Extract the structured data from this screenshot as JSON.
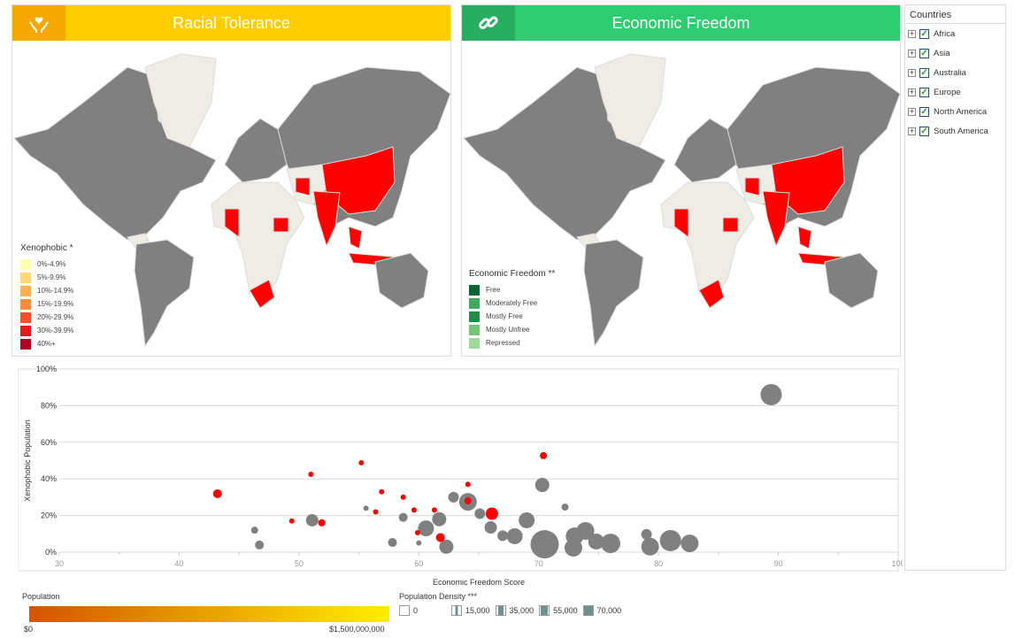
{
  "panels": {
    "racial": {
      "title": "Racial Tolerance",
      "icon": "hands-heart-icon",
      "header_color": "#ffcc00",
      "icon_bg": "#f5a800",
      "legend_title": "Xenophobic *",
      "legend": [
        {
          "label": "0%-4.9%",
          "color": "#ffffb2"
        },
        {
          "label": "5%-9.9%",
          "color": "#fed976"
        },
        {
          "label": "10%-14.9%",
          "color": "#feb24c"
        },
        {
          "label": "15%-19.9%",
          "color": "#fd8d3c"
        },
        {
          "label": "20%-29.9%",
          "color": "#fc4e2a"
        },
        {
          "label": "30%-39.9%",
          "color": "#e31a1c"
        },
        {
          "label": "40%+",
          "color": "#b10026"
        }
      ]
    },
    "economic": {
      "title": "Economic Freedom",
      "icon": "link-icon",
      "header_color": "#2ecc71",
      "icon_bg": "#27ae60",
      "legend_title": "Economic Freedom **",
      "legend": [
        {
          "label": "Free",
          "color": "#006837"
        },
        {
          "label": "Moderately Free",
          "color": "#41ab5d"
        },
        {
          "label": "Mostly Free",
          "color": "#238b45"
        },
        {
          "label": "Mostly Unfree",
          "color": "#74c476"
        },
        {
          "label": "Repressed",
          "color": "#a1d99b"
        }
      ]
    }
  },
  "sidebar": {
    "title": "Countries",
    "items": [
      {
        "label": "Africa",
        "checked": true
      },
      {
        "label": "Asia",
        "checked": true
      },
      {
        "label": "Australia",
        "checked": true
      },
      {
        "label": "Europe",
        "checked": true
      },
      {
        "label": "North America",
        "checked": true
      },
      {
        "label": "South America",
        "checked": true
      }
    ]
  },
  "chart_data": {
    "type": "scatter",
    "xlabel": "Economic Freedom Score",
    "ylabel": "Xenophobic Population",
    "xlim": [
      30,
      100
    ],
    "ylim": [
      0,
      100
    ],
    "xticks": [
      "30",
      "40",
      "50",
      "60",
      "70",
      "80",
      "90",
      "100"
    ],
    "yticks": [
      "0%",
      "20%",
      "40%",
      "60%",
      "80%",
      "100%"
    ],
    "grid": true,
    "colors": {
      "xenophobic": "#ff0000",
      "other": "#808080"
    },
    "points": [
      {
        "x": 89.4,
        "y": 86,
        "s": 12,
        "c": "other"
      },
      {
        "x": 43.2,
        "y": 31.9,
        "s": 5,
        "c": "xenophobic"
      },
      {
        "x": 46.3,
        "y": 12,
        "s": 4,
        "c": "other"
      },
      {
        "x": 46.7,
        "y": 3.9,
        "s": 5,
        "c": "other"
      },
      {
        "x": 49.4,
        "y": 17,
        "s": 3,
        "c": "xenophobic"
      },
      {
        "x": 51.0,
        "y": 42.5,
        "s": 3,
        "c": "xenophobic"
      },
      {
        "x": 51.1,
        "y": 17.4,
        "s": 7,
        "c": "other"
      },
      {
        "x": 51.9,
        "y": 16,
        "s": 4,
        "c": "xenophobic"
      },
      {
        "x": 55.2,
        "y": 48.8,
        "s": 3,
        "c": "xenophobic"
      },
      {
        "x": 55.6,
        "y": 24,
        "s": 3,
        "c": "other"
      },
      {
        "x": 56.4,
        "y": 22,
        "s": 3,
        "c": "xenophobic"
      },
      {
        "x": 56.9,
        "y": 33,
        "s": 3,
        "c": "xenophobic"
      },
      {
        "x": 57.8,
        "y": 5.3,
        "s": 5,
        "c": "other"
      },
      {
        "x": 58.7,
        "y": 19,
        "s": 5,
        "c": "other"
      },
      {
        "x": 58.7,
        "y": 30,
        "s": 3,
        "c": "xenophobic"
      },
      {
        "x": 59.6,
        "y": 23,
        "s": 3,
        "c": "xenophobic"
      },
      {
        "x": 60.0,
        "y": 5,
        "s": 3,
        "c": "other"
      },
      {
        "x": 59.9,
        "y": 10.6,
        "s": 3,
        "c": "xenophobic"
      },
      {
        "x": 60.6,
        "y": 13,
        "s": 9,
        "c": "other"
      },
      {
        "x": 61.3,
        "y": 23,
        "s": 3,
        "c": "xenophobic"
      },
      {
        "x": 61.7,
        "y": 18,
        "s": 8,
        "c": "other"
      },
      {
        "x": 61.8,
        "y": 8,
        "s": 5,
        "c": "xenophobic"
      },
      {
        "x": 62.3,
        "y": 3,
        "s": 8,
        "c": "other"
      },
      {
        "x": 62.9,
        "y": 30,
        "s": 6,
        "c": "other"
      },
      {
        "x": 64.1,
        "y": 27.5,
        "s": 10,
        "c": "other"
      },
      {
        "x": 64.1,
        "y": 28,
        "s": 4,
        "c": "xenophobic"
      },
      {
        "x": 64.1,
        "y": 37,
        "s": 3,
        "c": "xenophobic"
      },
      {
        "x": 65.1,
        "y": 21,
        "s": 6,
        "c": "other"
      },
      {
        "x": 66.1,
        "y": 21,
        "s": 7,
        "c": "xenophobic"
      },
      {
        "x": 66.0,
        "y": 13.5,
        "s": 7,
        "c": "other"
      },
      {
        "x": 67.0,
        "y": 9,
        "s": 6,
        "c": "other"
      },
      {
        "x": 68.0,
        "y": 8.7,
        "s": 9,
        "c": "other"
      },
      {
        "x": 69.0,
        "y": 17.4,
        "s": 9,
        "c": "other"
      },
      {
        "x": 70.3,
        "y": 36.7,
        "s": 8,
        "c": "other"
      },
      {
        "x": 70.4,
        "y": 52.7,
        "s": 4,
        "c": "xenophobic"
      },
      {
        "x": 70.5,
        "y": 4.3,
        "s": 16,
        "c": "other"
      },
      {
        "x": 72.2,
        "y": 24.6,
        "s": 4,
        "c": "other"
      },
      {
        "x": 72.9,
        "y": 2.4,
        "s": 10,
        "c": "other"
      },
      {
        "x": 73.0,
        "y": 8.7,
        "s": 10,
        "c": "other"
      },
      {
        "x": 73.9,
        "y": 11.6,
        "s": 10,
        "c": "other"
      },
      {
        "x": 74.8,
        "y": 5.8,
        "s": 9,
        "c": "other"
      },
      {
        "x": 76.0,
        "y": 4.8,
        "s": 11,
        "c": "other"
      },
      {
        "x": 79.0,
        "y": 9.7,
        "s": 6,
        "c": "other"
      },
      {
        "x": 79.3,
        "y": 3,
        "s": 10,
        "c": "other"
      },
      {
        "x": 81.0,
        "y": 6.3,
        "s": 12,
        "c": "other"
      },
      {
        "x": 82.6,
        "y": 4.8,
        "s": 10,
        "c": "other"
      }
    ]
  },
  "bottom_legend": {
    "population": {
      "title": "Population",
      "min": "$0",
      "max": "$1,500,000,000",
      "from": "#d35400",
      "to": "#ffee00"
    },
    "density": {
      "title": "Population Density ***",
      "items": [
        "0",
        "15,000",
        "35,000",
        "55,000",
        "70,000"
      ],
      "fills": [
        0,
        0.3,
        0.55,
        0.8,
        1
      ],
      "color": "#6e9090"
    }
  }
}
